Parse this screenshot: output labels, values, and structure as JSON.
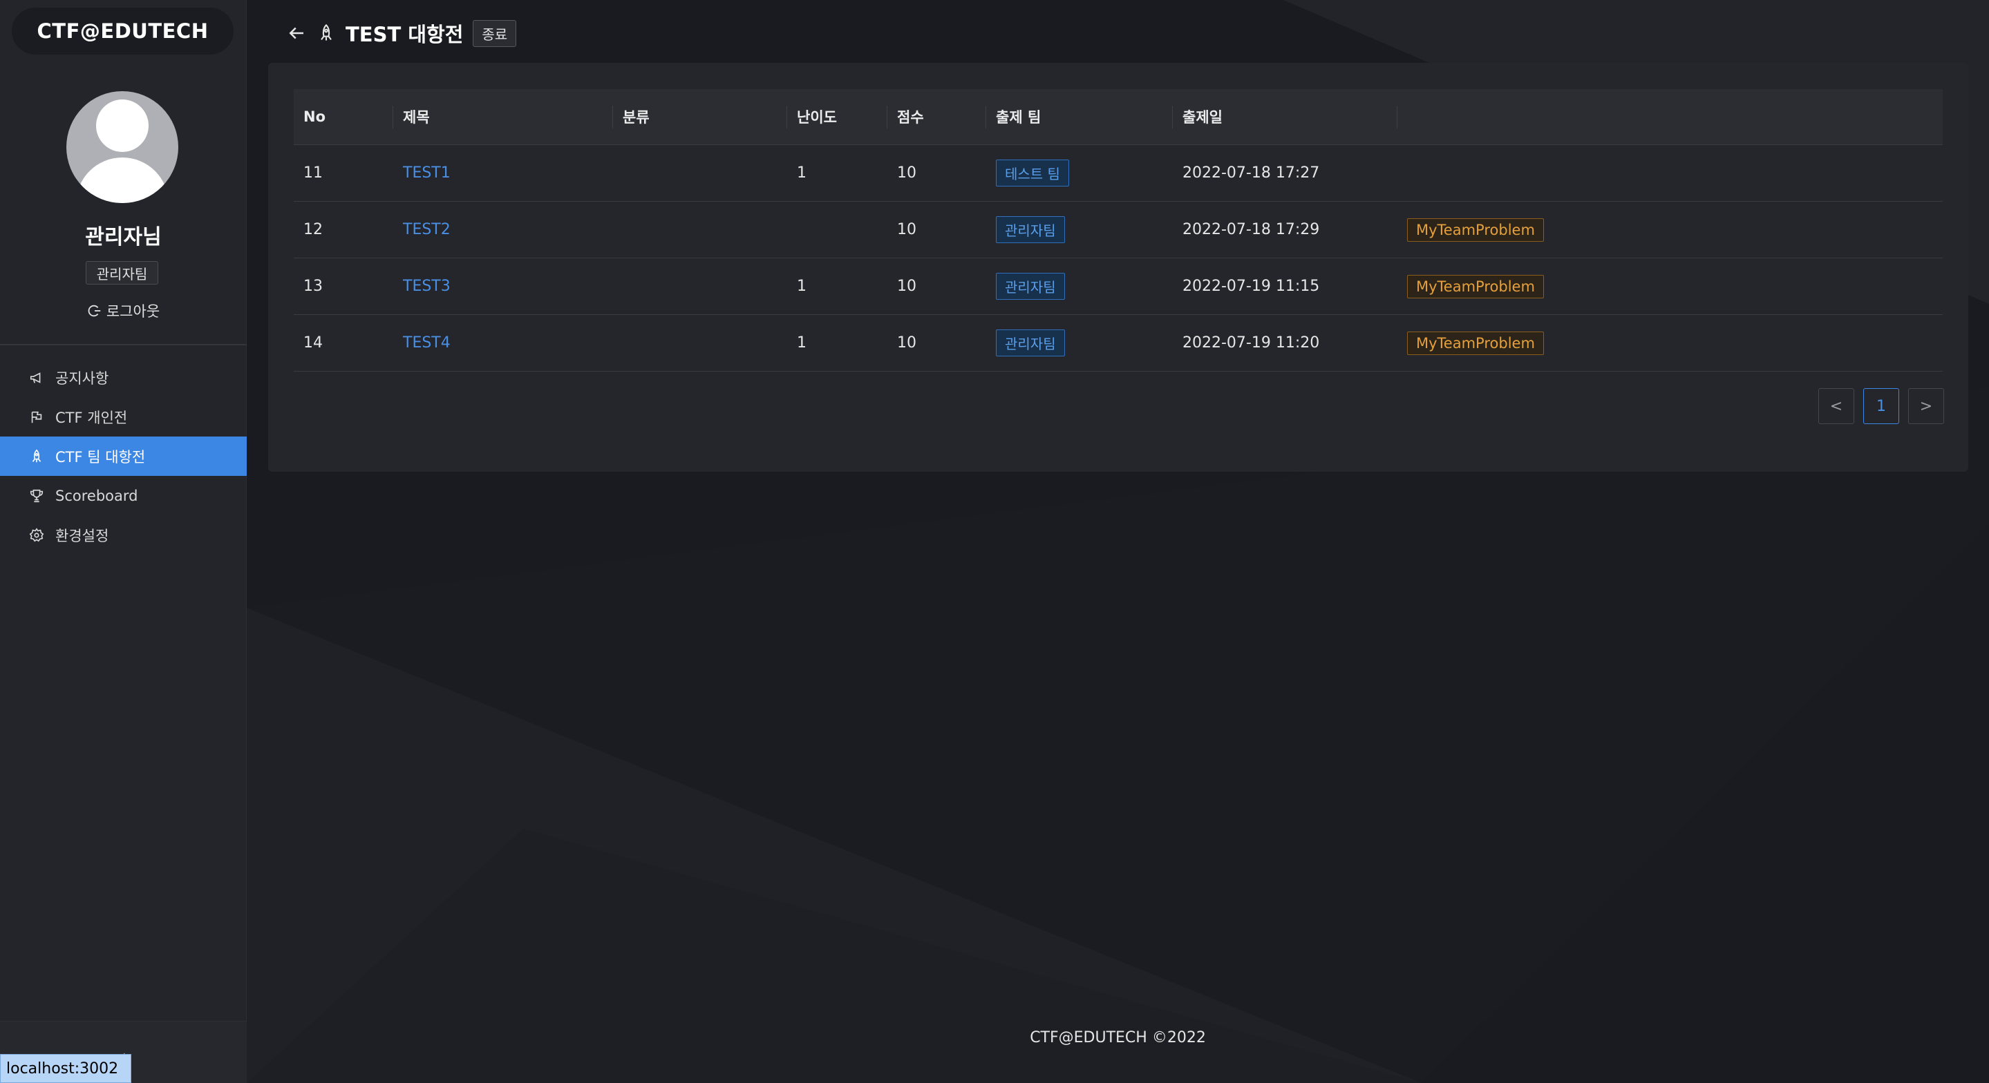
{
  "app": {
    "logo": "CTF@EDUTECH"
  },
  "user": {
    "name": "관리자님",
    "team": "관리자팀",
    "logout_label": "로그아웃"
  },
  "menu": [
    {
      "label": "공지사항",
      "icon": "megaphone-icon",
      "active": false
    },
    {
      "label": "CTF 개인전",
      "icon": "flag-icon",
      "active": false
    },
    {
      "label": "CTF 팀 대항전",
      "icon": "rocket-icon",
      "active": true
    },
    {
      "label": "Scoreboard",
      "icon": "trophy-icon",
      "active": false
    },
    {
      "label": "환경설정",
      "icon": "gear-icon",
      "active": false
    }
  ],
  "header": {
    "title": "TEST 대항전",
    "status": "종료"
  },
  "table": {
    "columns": [
      "No",
      "제목",
      "분류",
      "난이도",
      "점수",
      "출제 팀",
      "출제일",
      ""
    ],
    "rows": [
      {
        "no": "11",
        "title": "TEST1",
        "category": "",
        "difficulty": "1",
        "score": "10",
        "team": "테스트 팀",
        "date": "2022-07-18 17:27",
        "tag": ""
      },
      {
        "no": "12",
        "title": "TEST2",
        "category": "",
        "difficulty": "",
        "score": "10",
        "team": "관리자팀",
        "date": "2022-07-18 17:29",
        "tag": "MyTeamProblem"
      },
      {
        "no": "13",
        "title": "TEST3",
        "category": "",
        "difficulty": "1",
        "score": "10",
        "team": "관리자팀",
        "date": "2022-07-19 11:15",
        "tag": "MyTeamProblem"
      },
      {
        "no": "14",
        "title": "TEST4",
        "category": "",
        "difficulty": "1",
        "score": "10",
        "team": "관리자팀",
        "date": "2022-07-19 11:20",
        "tag": "MyTeamProblem"
      }
    ]
  },
  "pagination": {
    "prev": "<",
    "current": "1",
    "next": ">"
  },
  "footer": {
    "text": "CTF@EDUTECH ©2022"
  },
  "status_bar": {
    "url": "localhost:3002"
  },
  "colors": {
    "accent": "#3c87e3",
    "link": "#4a8fe2",
    "tag_gold": "#e5a03b"
  }
}
